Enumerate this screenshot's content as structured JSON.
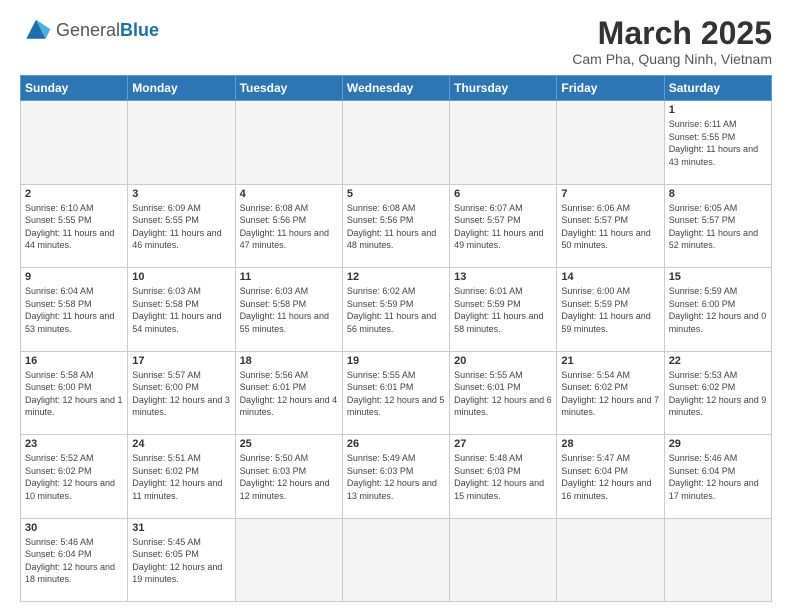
{
  "header": {
    "logo_general": "General",
    "logo_blue": "Blue",
    "month_title": "March 2025",
    "location": "Cam Pha, Quang Ninh, Vietnam"
  },
  "days_of_week": [
    "Sunday",
    "Monday",
    "Tuesday",
    "Wednesday",
    "Thursday",
    "Friday",
    "Saturday"
  ],
  "weeks": [
    [
      {
        "day": "",
        "empty": true
      },
      {
        "day": "",
        "empty": true
      },
      {
        "day": "",
        "empty": true
      },
      {
        "day": "",
        "empty": true
      },
      {
        "day": "",
        "empty": true
      },
      {
        "day": "",
        "empty": true
      },
      {
        "day": "1",
        "sunrise": "6:11 AM",
        "sunset": "5:55 PM",
        "daylight": "11 hours and 43 minutes."
      }
    ],
    [
      {
        "day": "2",
        "sunrise": "6:10 AM",
        "sunset": "5:55 PM",
        "daylight": "11 hours and 44 minutes."
      },
      {
        "day": "3",
        "sunrise": "6:09 AM",
        "sunset": "5:55 PM",
        "daylight": "11 hours and 46 minutes."
      },
      {
        "day": "4",
        "sunrise": "6:08 AM",
        "sunset": "5:56 PM",
        "daylight": "11 hours and 47 minutes."
      },
      {
        "day": "5",
        "sunrise": "6:08 AM",
        "sunset": "5:56 PM",
        "daylight": "11 hours and 48 minutes."
      },
      {
        "day": "6",
        "sunrise": "6:07 AM",
        "sunset": "5:57 PM",
        "daylight": "11 hours and 49 minutes."
      },
      {
        "day": "7",
        "sunrise": "6:06 AM",
        "sunset": "5:57 PM",
        "daylight": "11 hours and 50 minutes."
      },
      {
        "day": "8",
        "sunrise": "6:05 AM",
        "sunset": "5:57 PM",
        "daylight": "11 hours and 52 minutes."
      }
    ],
    [
      {
        "day": "9",
        "sunrise": "6:04 AM",
        "sunset": "5:58 PM",
        "daylight": "11 hours and 53 minutes."
      },
      {
        "day": "10",
        "sunrise": "6:03 AM",
        "sunset": "5:58 PM",
        "daylight": "11 hours and 54 minutes."
      },
      {
        "day": "11",
        "sunrise": "6:03 AM",
        "sunset": "5:58 PM",
        "daylight": "11 hours and 55 minutes."
      },
      {
        "day": "12",
        "sunrise": "6:02 AM",
        "sunset": "5:59 PM",
        "daylight": "11 hours and 56 minutes."
      },
      {
        "day": "13",
        "sunrise": "6:01 AM",
        "sunset": "5:59 PM",
        "daylight": "11 hours and 58 minutes."
      },
      {
        "day": "14",
        "sunrise": "6:00 AM",
        "sunset": "5:59 PM",
        "daylight": "11 hours and 59 minutes."
      },
      {
        "day": "15",
        "sunrise": "5:59 AM",
        "sunset": "6:00 PM",
        "daylight": "12 hours and 0 minutes."
      }
    ],
    [
      {
        "day": "16",
        "sunrise": "5:58 AM",
        "sunset": "6:00 PM",
        "daylight": "12 hours and 1 minute."
      },
      {
        "day": "17",
        "sunrise": "5:57 AM",
        "sunset": "6:00 PM",
        "daylight": "12 hours and 3 minutes."
      },
      {
        "day": "18",
        "sunrise": "5:56 AM",
        "sunset": "6:01 PM",
        "daylight": "12 hours and 4 minutes."
      },
      {
        "day": "19",
        "sunrise": "5:55 AM",
        "sunset": "6:01 PM",
        "daylight": "12 hours and 5 minutes."
      },
      {
        "day": "20",
        "sunrise": "5:55 AM",
        "sunset": "6:01 PM",
        "daylight": "12 hours and 6 minutes."
      },
      {
        "day": "21",
        "sunrise": "5:54 AM",
        "sunset": "6:02 PM",
        "daylight": "12 hours and 7 minutes."
      },
      {
        "day": "22",
        "sunrise": "5:53 AM",
        "sunset": "6:02 PM",
        "daylight": "12 hours and 9 minutes."
      }
    ],
    [
      {
        "day": "23",
        "sunrise": "5:52 AM",
        "sunset": "6:02 PM",
        "daylight": "12 hours and 10 minutes."
      },
      {
        "day": "24",
        "sunrise": "5:51 AM",
        "sunset": "6:02 PM",
        "daylight": "12 hours and 11 minutes."
      },
      {
        "day": "25",
        "sunrise": "5:50 AM",
        "sunset": "6:03 PM",
        "daylight": "12 hours and 12 minutes."
      },
      {
        "day": "26",
        "sunrise": "5:49 AM",
        "sunset": "6:03 PM",
        "daylight": "12 hours and 13 minutes."
      },
      {
        "day": "27",
        "sunrise": "5:48 AM",
        "sunset": "6:03 PM",
        "daylight": "12 hours and 15 minutes."
      },
      {
        "day": "28",
        "sunrise": "5:47 AM",
        "sunset": "6:04 PM",
        "daylight": "12 hours and 16 minutes."
      },
      {
        "day": "29",
        "sunrise": "5:46 AM",
        "sunset": "6:04 PM",
        "daylight": "12 hours and 17 minutes."
      }
    ],
    [
      {
        "day": "30",
        "sunrise": "5:46 AM",
        "sunset": "6:04 PM",
        "daylight": "12 hours and 18 minutes."
      },
      {
        "day": "31",
        "sunrise": "5:45 AM",
        "sunset": "6:05 PM",
        "daylight": "12 hours and 19 minutes."
      },
      {
        "day": "",
        "empty": true
      },
      {
        "day": "",
        "empty": true
      },
      {
        "day": "",
        "empty": true
      },
      {
        "day": "",
        "empty": true
      },
      {
        "day": "",
        "empty": true
      }
    ]
  ]
}
